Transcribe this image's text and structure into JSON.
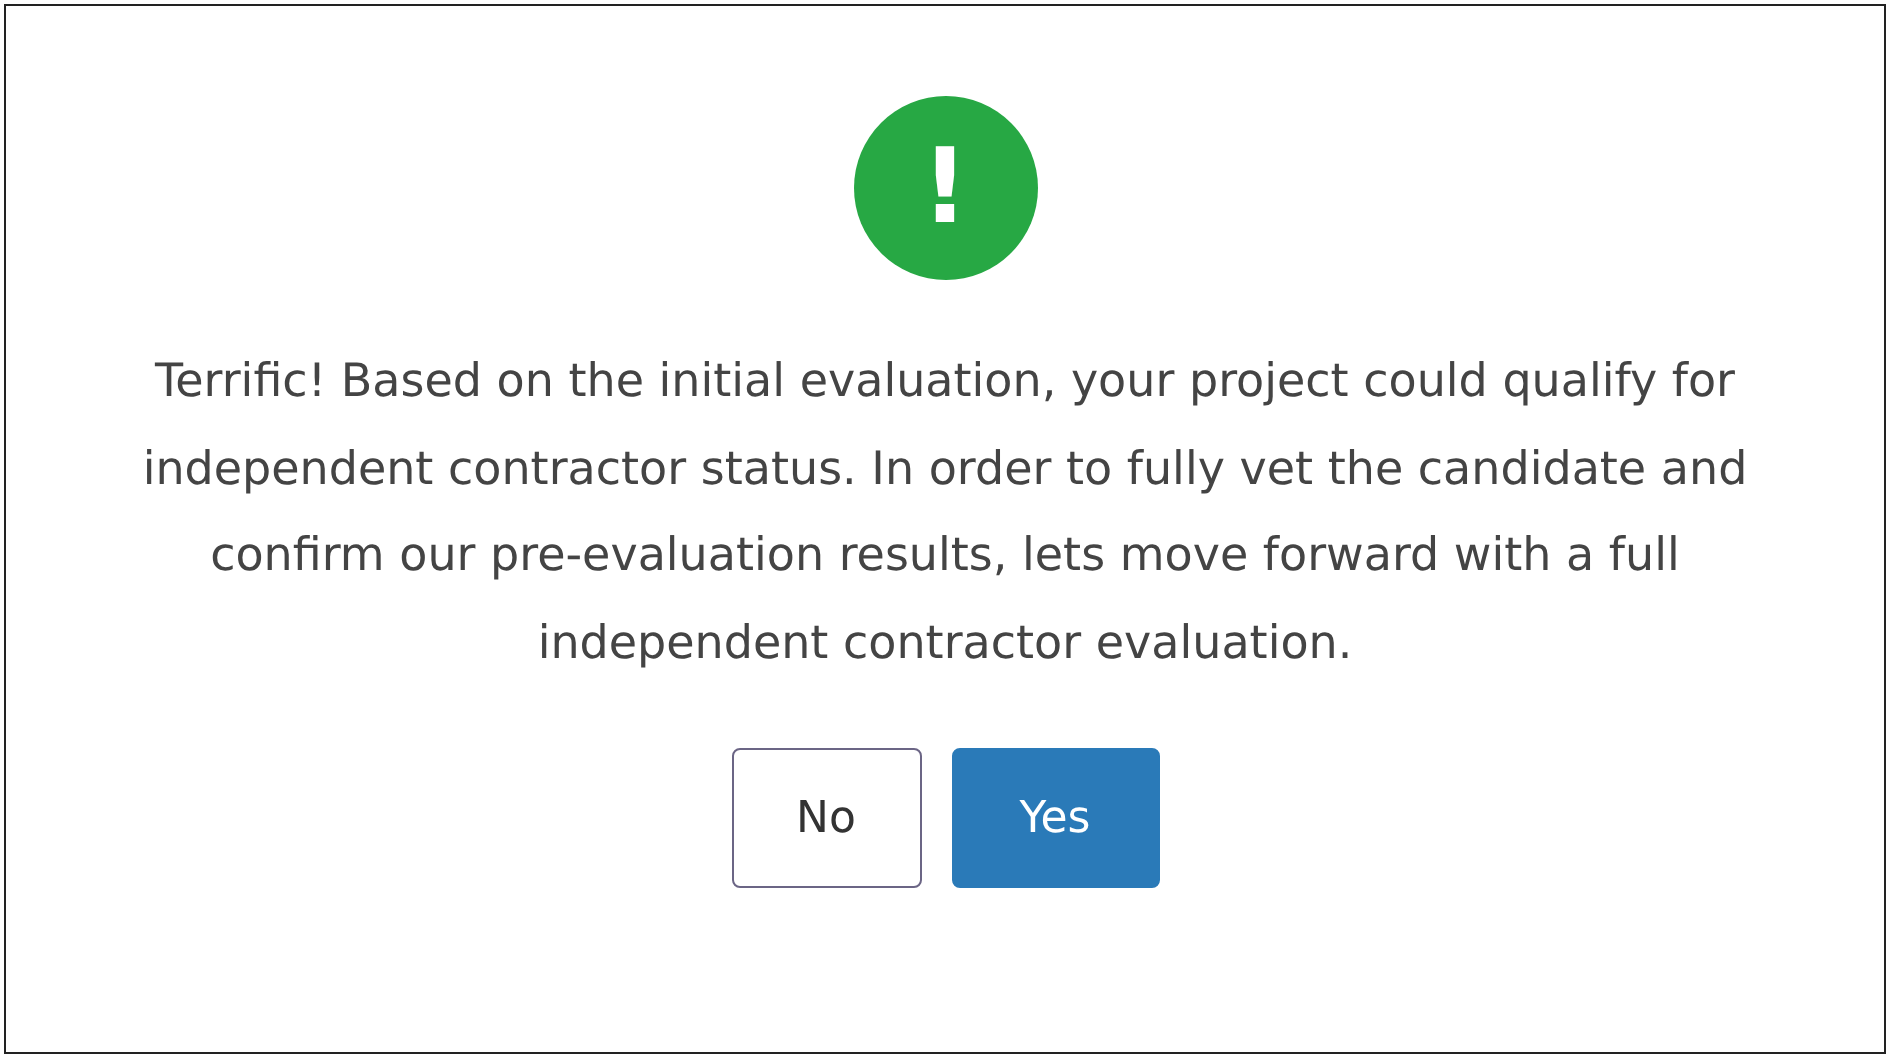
{
  "dialog": {
    "icon": "!",
    "message": "Terrific! Based on the initial evaluation, your project could qualify for independent contractor status. In order to fully vet the candidate and confirm our pre-evaluation results, lets move forward with a full independent contractor evaluation.",
    "buttons": [
      {
        "label": "No",
        "kind": "secondary"
      },
      {
        "label": "Yes",
        "kind": "primary"
      }
    ]
  }
}
